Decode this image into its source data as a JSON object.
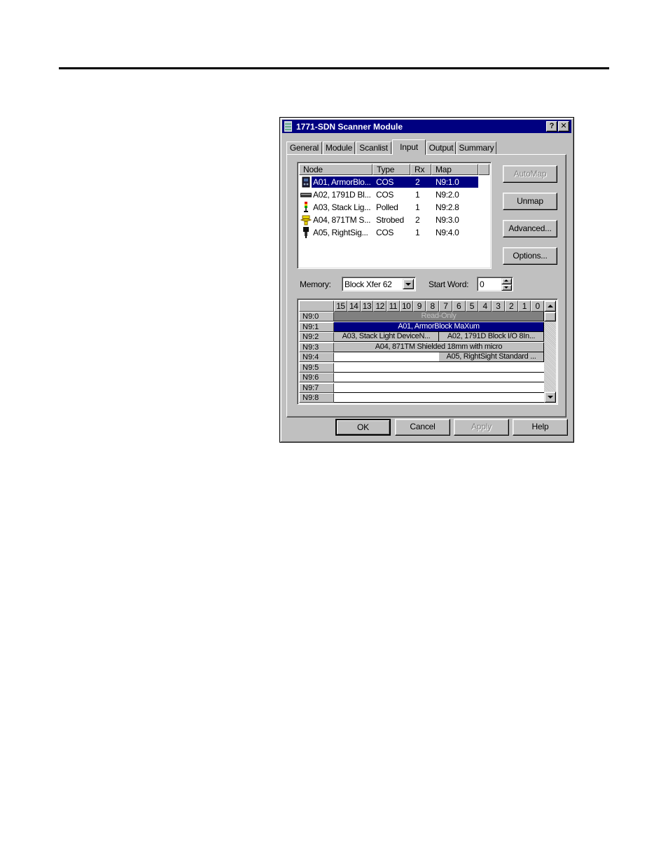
{
  "window": {
    "title": "1771-SDN Scanner Module",
    "help_glyph": "?",
    "close_glyph": "✕"
  },
  "tabs": [
    {
      "label": "General"
    },
    {
      "label": "Module"
    },
    {
      "label": "Scanlist"
    },
    {
      "label": "Input"
    },
    {
      "label": "Output"
    },
    {
      "label": "Summary"
    }
  ],
  "active_tab": "Input",
  "node_list": {
    "columns": [
      "Node",
      "Type",
      "Rx",
      "Map"
    ],
    "rows": [
      {
        "icon": "armorblock-icon",
        "node": "A01, ArmorBlo...",
        "type": "COS",
        "rx": "2",
        "map": "N9:1.0",
        "selected": true
      },
      {
        "icon": "block-io-icon",
        "node": "A02, 1791D Bl...",
        "type": "COS",
        "rx": "1",
        "map": "N9:2.0"
      },
      {
        "icon": "stack-light-icon",
        "node": "A03, Stack Lig...",
        "type": "Polled",
        "rx": "1",
        "map": "N9:2.8"
      },
      {
        "icon": "sensor-icon",
        "node": "A04, 871TM S...",
        "type": "Strobed",
        "rx": "2",
        "map": "N9:3.0"
      },
      {
        "icon": "photo-eye-icon",
        "node": "A05, RightSig...",
        "type": "COS",
        "rx": "1",
        "map": "N9:4.0"
      }
    ]
  },
  "side_buttons": {
    "automap": "AutoMap",
    "unmap": "Unmap",
    "advanced": "Advanced...",
    "options": "Options..."
  },
  "memory": {
    "label": "Memory:",
    "value": "Block Xfer 62"
  },
  "start_word": {
    "label": "Start Word:",
    "value": "0"
  },
  "bit_map": {
    "bit_columns": [
      "15",
      "14",
      "13",
      "12",
      "11",
      "10",
      "9",
      "8",
      "7",
      "6",
      "5",
      "4",
      "3",
      "2",
      "1",
      "0"
    ],
    "rows": [
      {
        "word": "N9:0",
        "segments": [
          {
            "text": "Read-Only",
            "style": "readonly",
            "from": 15,
            "to": 0
          }
        ]
      },
      {
        "word": "N9:1",
        "segments": [
          {
            "text": "A01, ArmorBlock MaXum",
            "style": "sel",
            "from": 15,
            "to": 0
          }
        ]
      },
      {
        "word": "N9:2",
        "segments": [
          {
            "text": "A03, Stack Light DeviceN...",
            "style": "plain",
            "from": 15,
            "to": 8
          },
          {
            "text": "A02, 1791D Block I/O 8In...",
            "style": "plain",
            "from": 7,
            "to": 0
          }
        ]
      },
      {
        "word": "N9:3",
        "segments": [
          {
            "text": "A04, 871TM Shielded 18mm with micro",
            "style": "plain",
            "from": 15,
            "to": 0
          }
        ]
      },
      {
        "word": "N9:4",
        "segments": [
          {
            "text": "A05, RightSight Standard ...",
            "style": "plain",
            "from": 7,
            "to": 0
          }
        ]
      },
      {
        "word": "N9:5",
        "segments": []
      },
      {
        "word": "N9:6",
        "segments": []
      },
      {
        "word": "N9:7",
        "segments": []
      },
      {
        "word": "N9:8",
        "segments": []
      }
    ]
  },
  "footer_buttons": {
    "ok": "OK",
    "cancel": "Cancel",
    "apply": "Apply",
    "help": "Help"
  }
}
